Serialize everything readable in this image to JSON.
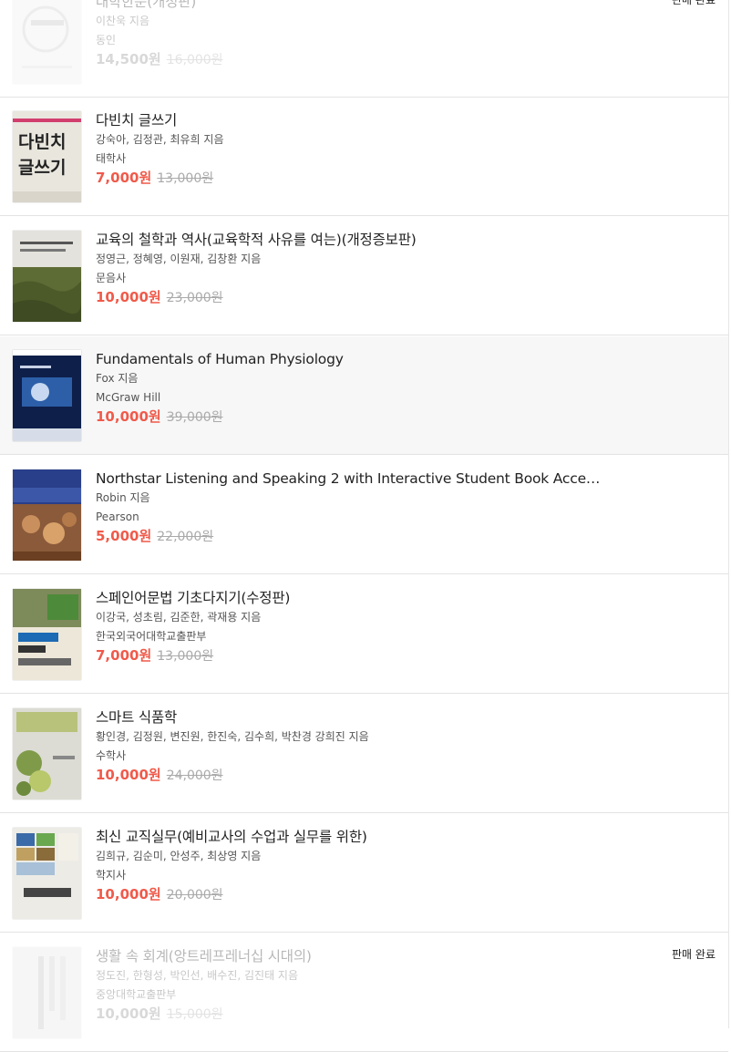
{
  "books": [
    {
      "title": "대학한문(개정판)",
      "author": "이찬욱 지음",
      "publisher": "동인",
      "price": "14,500원",
      "original_price": "16,000원",
      "sold_label": "판매 완료",
      "cover_icon": "book-cover-daehak-hanmun"
    },
    {
      "title": "다빈치 글쓰기",
      "author": "강숙아, 김정관, 최유희 지음",
      "publisher": "태학사",
      "price": "7,000원",
      "original_price": "13,000원",
      "cover_icon": "book-cover-davinci",
      "cover_text": [
        "다빈치",
        "글쓰기"
      ]
    },
    {
      "title": "교육의 철학과 역사(교육학적 사유를 여는)(개정증보판)",
      "author": "정영근, 정혜영, 이원재, 김창환 지음",
      "publisher": "문음사",
      "price": "10,000원",
      "original_price": "23,000원",
      "cover_icon": "book-cover-education-philosophy"
    },
    {
      "title": "Fundamentals of Human Physiology",
      "author": "Fox 지음",
      "publisher": "McGraw Hill",
      "price": "10,000원",
      "original_price": "39,000원",
      "cover_icon": "book-cover-human-physiology"
    },
    {
      "title": "Northstar Listening and Speaking 2 with Interactive Student Book Access...",
      "author": "Robin 지음",
      "publisher": "Pearson",
      "price": "5,000원",
      "original_price": "22,000원",
      "cover_icon": "book-cover-northstar"
    },
    {
      "title": "스페인어문법 기초다지기(수정판)",
      "author": "이강국, 성초림, 김준한, 곽재용 지음",
      "publisher": "한국외국어대학교출판부",
      "price": "7,000원",
      "original_price": "13,000원",
      "cover_icon": "book-cover-spanish-grammar"
    },
    {
      "title": "스마트 식품학",
      "author": "황인경, 김정원, 변진원, 한진숙, 김수희, 박찬경 강희진 지음",
      "publisher": "수학사",
      "price": "10,000원",
      "original_price": "24,000원",
      "cover_icon": "book-cover-food-science"
    },
    {
      "title": "최신 교직실무(예비교사의 수업과 실무를 위한)",
      "author": "김희규, 김순미, 안성주, 최상영 지음",
      "publisher": "학지사",
      "price": "10,000원",
      "original_price": "20,000원",
      "cover_icon": "book-cover-teaching-practice"
    },
    {
      "title": "생활 속 회계(앙트레프레너십 시대의)",
      "author": "정도진, 한형성, 박인선, 배수진, 김진태 지음",
      "publisher": "중앙대학교출판부",
      "price": "10,000원",
      "original_price": "15,000원",
      "sold_label": "판매 완료",
      "cover_icon": "book-cover-accounting"
    }
  ],
  "colors": {
    "sale_price": "#f05a4a",
    "original_price": "#aaaaaa",
    "divider": "#e3e3e3"
  }
}
